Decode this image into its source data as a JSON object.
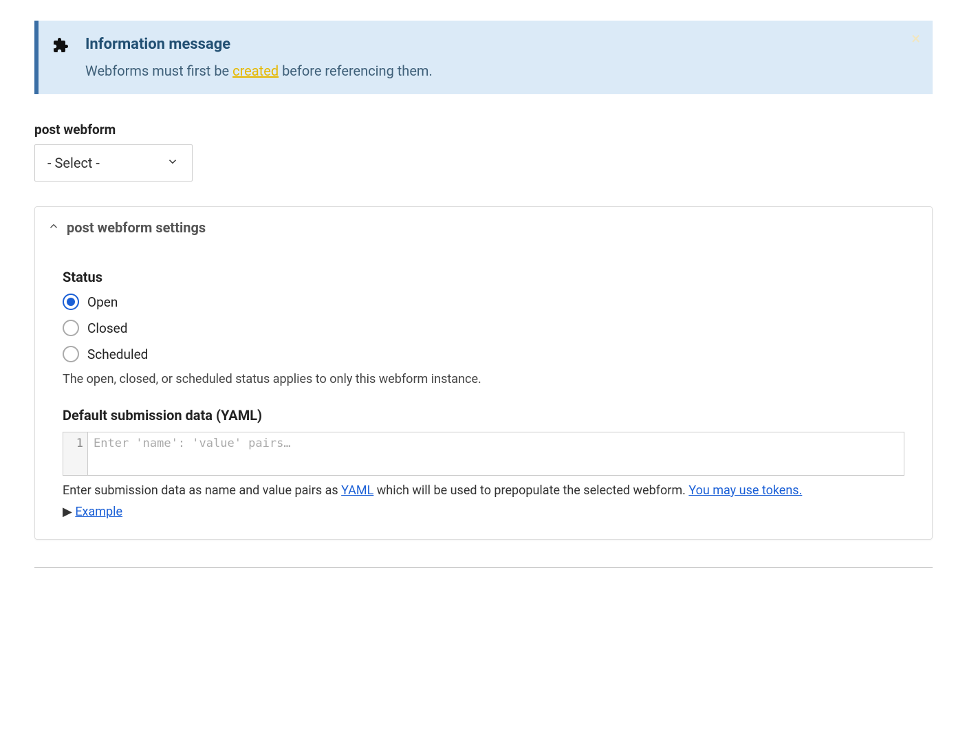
{
  "info": {
    "title": "Information message",
    "text_before": "Webforms must first be ",
    "link": "created",
    "text_after": " before referencing them."
  },
  "webform_select": {
    "label": "post webform",
    "selected": "- Select -"
  },
  "settings_panel": {
    "title": "post webform settings"
  },
  "status": {
    "label": "Status",
    "options": [
      "Open",
      "Closed",
      "Scheduled"
    ],
    "selected": "Open",
    "help": "The open, closed, or scheduled status applies to only this webform instance."
  },
  "yaml": {
    "label": "Default submission data (YAML)",
    "gutter_line": "1",
    "placeholder": "Enter 'name': 'value' pairs…",
    "desc_before": "Enter submission data as name and value pairs as ",
    "desc_link1": "YAML",
    "desc_mid": " which will be used to prepopulate the selected webform. ",
    "desc_link2": "You may use tokens.",
    "example_prefix": "▶ ",
    "example_link": "Example"
  }
}
